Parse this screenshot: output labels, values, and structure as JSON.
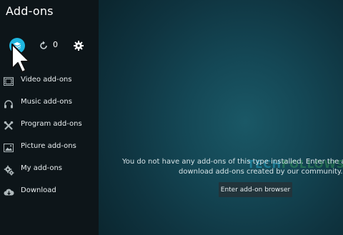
{
  "window": {
    "title": "Add-ons"
  },
  "toolbar": {
    "updates_count": "0",
    "icons": [
      "package-icon",
      "refresh-icon",
      "gear-icon"
    ]
  },
  "sidebar": {
    "items": [
      {
        "label": "Video add-ons",
        "icon": "film-icon"
      },
      {
        "label": "Music add-ons",
        "icon": "headphones-icon"
      },
      {
        "label": "Program add-ons",
        "icon": "tools-icon"
      },
      {
        "label": "Picture add-ons",
        "icon": "picture-icon"
      },
      {
        "label": "My add-ons",
        "icon": "gears-icon"
      },
      {
        "label": "Download",
        "icon": "cloud-download-icon"
      }
    ]
  },
  "main": {
    "message_line1": "You do not have any add-ons of this type installed. Enter the add-",
    "message_line2": "download add-ons created by our community.",
    "browser_button_label": "Enter add-on browser"
  },
  "watermark": {
    "part1": "TECH",
    "part2": "FOLLOWS"
  },
  "colors": {
    "accent": "#1fb6df",
    "sidebar_bg": "#0d1519",
    "main_bg": "#144755",
    "button_bg": "#22343b"
  }
}
